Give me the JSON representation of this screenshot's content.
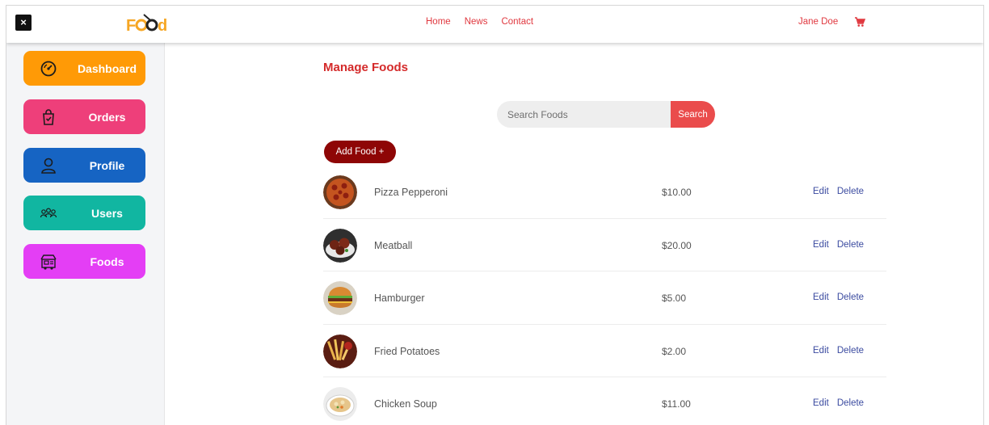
{
  "window": {
    "close_label": "×"
  },
  "header": {
    "logo_text": "Food",
    "nav": [
      "Home",
      "News",
      "Contact"
    ],
    "user_name": "Jane Doe",
    "cart_icon": "cart-icon"
  },
  "sidebar": {
    "items": [
      {
        "label": "Dashboard",
        "icon": "gauge-icon",
        "color": "#ff9a06"
      },
      {
        "label": "Orders",
        "icon": "shopping-bag-icon",
        "color": "#ee3f7a"
      },
      {
        "label": "Profile",
        "icon": "user-icon",
        "color": "#1664c3"
      },
      {
        "label": "Users",
        "icon": "users-icon",
        "color": "#11b6a1"
      },
      {
        "label": "Foods",
        "icon": "food-truck-icon",
        "color": "#e43ef5"
      }
    ]
  },
  "main": {
    "title": "Manage Foods",
    "search": {
      "placeholder": "Search Foods",
      "button_label": "Search"
    },
    "add_button_label": "Add Food +",
    "foods": [
      {
        "name": "Pizza Pepperoni",
        "price": "$10.00",
        "edit": "Edit",
        "delete": "Delete"
      },
      {
        "name": "Meatball",
        "price": "$20.00",
        "edit": "Edit",
        "delete": "Delete"
      },
      {
        "name": "Hamburger",
        "price": "$5.00",
        "edit": "Edit",
        "delete": "Delete"
      },
      {
        "name": "Fried Potatoes",
        "price": "$2.00",
        "edit": "Edit",
        "delete": "Delete"
      },
      {
        "name": "Chicken Soup",
        "price": "$11.00",
        "edit": "Edit",
        "delete": "Delete"
      }
    ]
  },
  "colors": {
    "accent_red": "#e0383f",
    "search_button": "#ea4c4c",
    "add_button": "#8e0606",
    "link_blue": "#3b4ba0"
  }
}
